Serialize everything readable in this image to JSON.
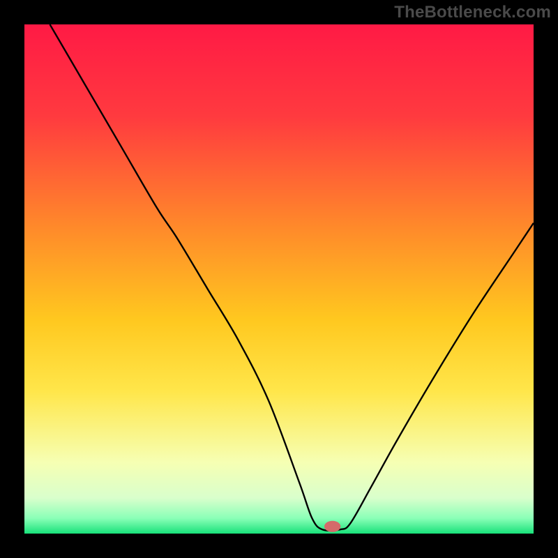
{
  "watermark": "TheBottleneck.com",
  "chart_data": {
    "type": "line",
    "title": "",
    "xlabel": "",
    "ylabel": "",
    "xlim": [
      0,
      100
    ],
    "ylim": [
      0,
      100
    ],
    "grid": false,
    "gradient_stops": [
      {
        "offset": 0,
        "color": "#ff1a45"
      },
      {
        "offset": 18,
        "color": "#ff3a3f"
      },
      {
        "offset": 40,
        "color": "#ff8a2a"
      },
      {
        "offset": 58,
        "color": "#ffc81f"
      },
      {
        "offset": 72,
        "color": "#ffe64a"
      },
      {
        "offset": 86,
        "color": "#f6ffb3"
      },
      {
        "offset": 93,
        "color": "#d9ffcc"
      },
      {
        "offset": 97,
        "color": "#8affb7"
      },
      {
        "offset": 100,
        "color": "#18e27a"
      }
    ],
    "series": [
      {
        "name": "bottleneck-curve",
        "x": [
          5,
          12,
          19,
          26,
          30,
          36,
          42,
          48,
          54,
          56.5,
          58.5,
          62,
          64,
          68,
          73,
          80,
          88,
          96,
          100
        ],
        "y": [
          100,
          88,
          76,
          64,
          58,
          48,
          38,
          26,
          10,
          3,
          0.8,
          0.8,
          2,
          9,
          18,
          30,
          43,
          55,
          61
        ]
      }
    ],
    "marker": {
      "x": 60.5,
      "y": 1.4,
      "rx": 1.6,
      "ry": 1.1,
      "color": "#d46a6a"
    },
    "curve_color": "#000000",
    "curve_width": 2.4
  }
}
